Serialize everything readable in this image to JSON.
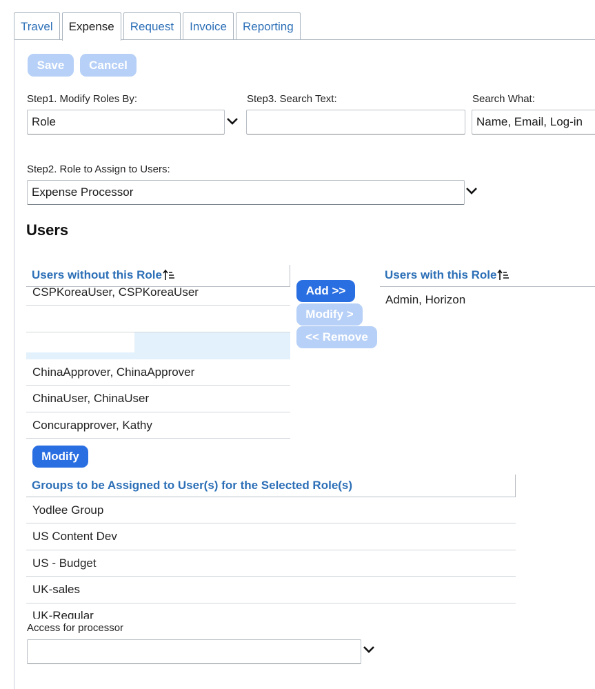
{
  "tabs": [
    {
      "label": "Travel",
      "active": false
    },
    {
      "label": "Expense",
      "active": true
    },
    {
      "label": "Request",
      "active": false
    },
    {
      "label": "Invoice",
      "active": false
    },
    {
      "label": "Reporting",
      "active": false
    }
  ],
  "toolbar": {
    "save_label": "Save",
    "cancel_label": "Cancel"
  },
  "step1": {
    "label": "Step1. Modify Roles By:",
    "value": "Role"
  },
  "step3": {
    "label": "Step3. Search Text:",
    "value": ""
  },
  "search_what": {
    "label": "Search What:",
    "value": "Name, Email, Log-in"
  },
  "step2": {
    "label": "Step2. Role to Assign to Users:",
    "value": "Expense Processor"
  },
  "users_heading": "Users",
  "users_without": {
    "header": "Users without this Role",
    "rows": [
      "CSPKoreaUser, CSPKoreaUser",
      "",
      "",
      "ChinaApprover, ChinaApprover",
      "ChinaUser, ChinaUser",
      "Concurapprover, Kathy"
    ]
  },
  "users_with": {
    "header": "Users with this Role",
    "rows": [
      "Admin, Horizon"
    ]
  },
  "transfer": {
    "add_label": "Add >>",
    "modify_label": "Modify >",
    "remove_label": "<< Remove"
  },
  "modify_button_label": "Modify",
  "groups": {
    "header": "Groups to be Assigned to User(s) for the Selected Role(s)",
    "rows": [
      "Yodlee Group",
      "US Content Dev",
      "US - Budget",
      "UK-sales",
      "UK-Regular"
    ]
  },
  "access": {
    "label": "Access for processor",
    "value": ""
  },
  "colors": {
    "accent": "#2a6fe2",
    "link": "#2c6fb7",
    "disabled": "#b7d0f7",
    "highlight": "#e3f1fc"
  }
}
